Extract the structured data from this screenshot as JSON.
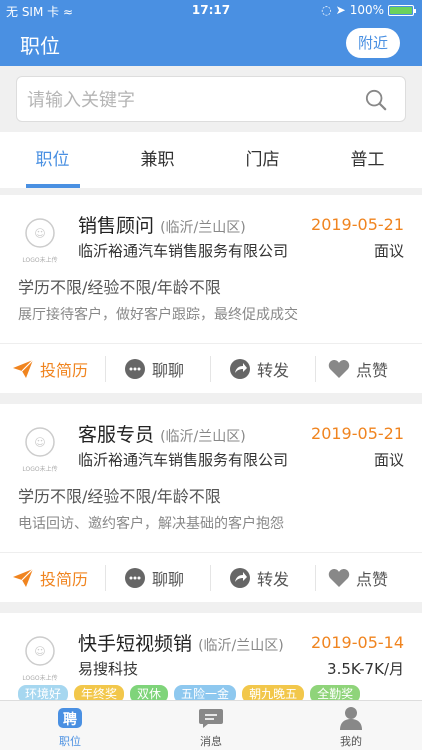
{
  "status_bar": {
    "carrier": "无 SIM 卡",
    "time": "17:17",
    "battery": "100%"
  },
  "nav": {
    "title": "职位",
    "nearby_button": "附近"
  },
  "search": {
    "placeholder": "请输入关键字"
  },
  "tabs": [
    {
      "label": "职位",
      "active": true
    },
    {
      "label": "兼职",
      "active": false
    },
    {
      "label": "门店",
      "active": false
    },
    {
      "label": "普工",
      "active": false
    }
  ],
  "logo_text": "LOGO未上传",
  "jobs": [
    {
      "title": "销售顾问",
      "location": "(临沂/兰山区)",
      "date": "2019-05-21",
      "company": "临沂裕通汽车销售服务有限公司",
      "salary": "面议",
      "requirements": "学历不限/经验不限/年龄不限",
      "description": "展厅接待客户，做好客户跟踪，最终促成成交"
    },
    {
      "title": "客服专员",
      "location": "(临沂/兰山区)",
      "date": "2019-05-21",
      "company": "临沂裕通汽车销售服务有限公司",
      "salary": "面议",
      "requirements": "学历不限/经验不限/年龄不限",
      "description": "电话回访、邀约客户，解决基础的客户抱怨"
    },
    {
      "title": "快手短视频销",
      "location": "(临沂/兰山区)",
      "date": "2019-05-14",
      "company": "易搜科技",
      "salary": "3.5K-7K/月",
      "tags": [
        "环境好",
        "年终奖",
        "双休",
        "五险一金",
        "朝九晚五",
        "全勤奖"
      ]
    }
  ],
  "actions": {
    "apply": "投简历",
    "chat": "聊聊",
    "share": "转发",
    "like": "点赞"
  },
  "tag_colors": [
    "#a6d7f0",
    "#f2c74b",
    "#7fd47a",
    "#8ec8ef",
    "#f2c74b",
    "#8fd47a"
  ],
  "tabbar": [
    {
      "label": "职位",
      "icon": "job-icon",
      "active": true
    },
    {
      "label": "消息",
      "icon": "message-icon",
      "active": false
    },
    {
      "label": "我的",
      "icon": "profile-icon",
      "active": false
    }
  ],
  "colors": {
    "primary": "#4a90e2",
    "accent": "#f0841f"
  }
}
